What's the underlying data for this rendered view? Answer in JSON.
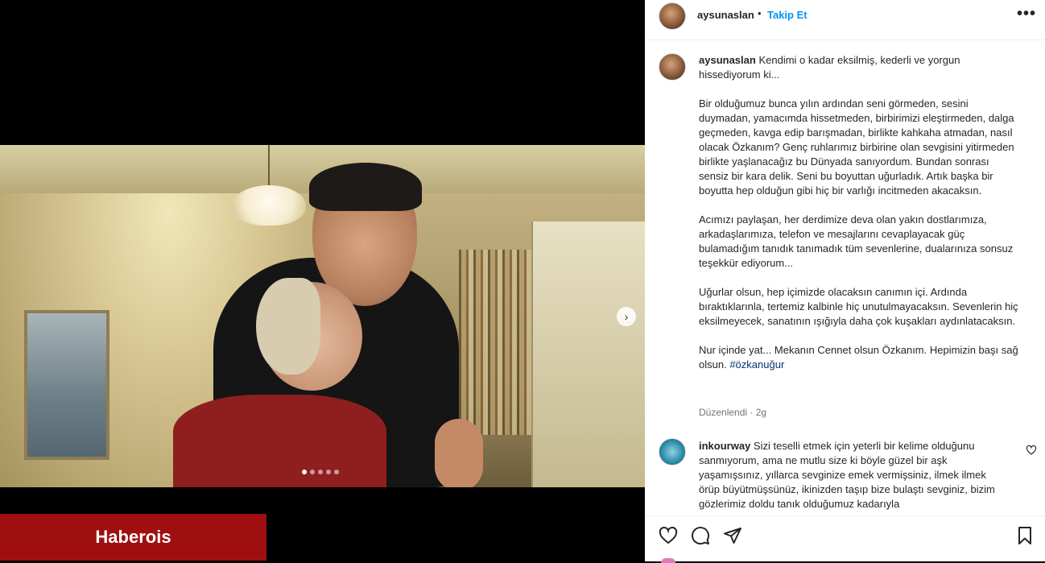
{
  "post": {
    "carousel": {
      "slide_count": 5,
      "active_slide": 1,
      "next_glyph": "›"
    },
    "watermark": "Haberois"
  },
  "header": {
    "username": "aysunaslan",
    "separator": "•",
    "follow_label": "Takip Et",
    "more_label": "•••"
  },
  "caption": {
    "username": "aysunaslan",
    "paragraphs": [
      "Kendimi o kadar eksilmiş, kederli ve yorgun hissediyorum ki...",
      "Bir olduğumuz bunca yılın ardından seni görmeden, sesini duymadan, yamacımda hissetmeden, birbirimizi eleştirmeden, dalga geçmeden, kavga edip barışmadan, birlikte kahkaha atmadan, nasıl olacak Özkanım? Genç ruhlarımız birbirine olan sevgisini yitirmeden birlikte yaşlanacağız bu Dünyada sanıyordum. Bundan sonrası sensiz bir kara delik. Seni bu boyuttan uğurladık. Artık başka bir boyutta hep olduğun gibi hiç bir varlığı incitmeden akacaksın.",
      "Acımızı paylaşan, her derdimize deva olan yakın dostlarımıza, arkadaşlarımıza, telefon ve mesajlarını cevaplayacak güç bulamadığım tanıdık tanımadık tüm sevenlerine, dualarınıza sonsuz teşekkür ediyorum...",
      "Uğurlar olsun, hep içimizde olacaksın canımın içi. Ardında bıraktıklarınla, tertemiz kalbinle hiç unutulmayacaksın. Sevenlerin hiç eksilmeyecek, sanatının ışığıyla daha çok kuşakları aydınlatacaksın.",
      "Nur içinde yat... Mekanın Cennet olsun Özkanım. Hepimizin başı sağ olsun."
    ],
    "hashtag": "#özkanuğur",
    "meta": "Düzenlendi · 2g"
  },
  "comment": {
    "username": "inkourway",
    "text": "Sizi teselli etmek için yeterli bir kelime olduğunu sanmıyorum, ama ne mutlu size ki böyle güzel bir aşk yaşamışsınız, yıllarca sevginize emek vermişsiniz, ilmek ilmek örüp büyütmüşsünüz, ikinizden taşıp bize bulaştı sevginiz, bizim gözlerimiz doldu tanık olduğumuz kadarıyla"
  },
  "actions": {
    "icons": [
      "heart-icon",
      "comment-icon",
      "share-icon",
      "save-icon"
    ]
  }
}
